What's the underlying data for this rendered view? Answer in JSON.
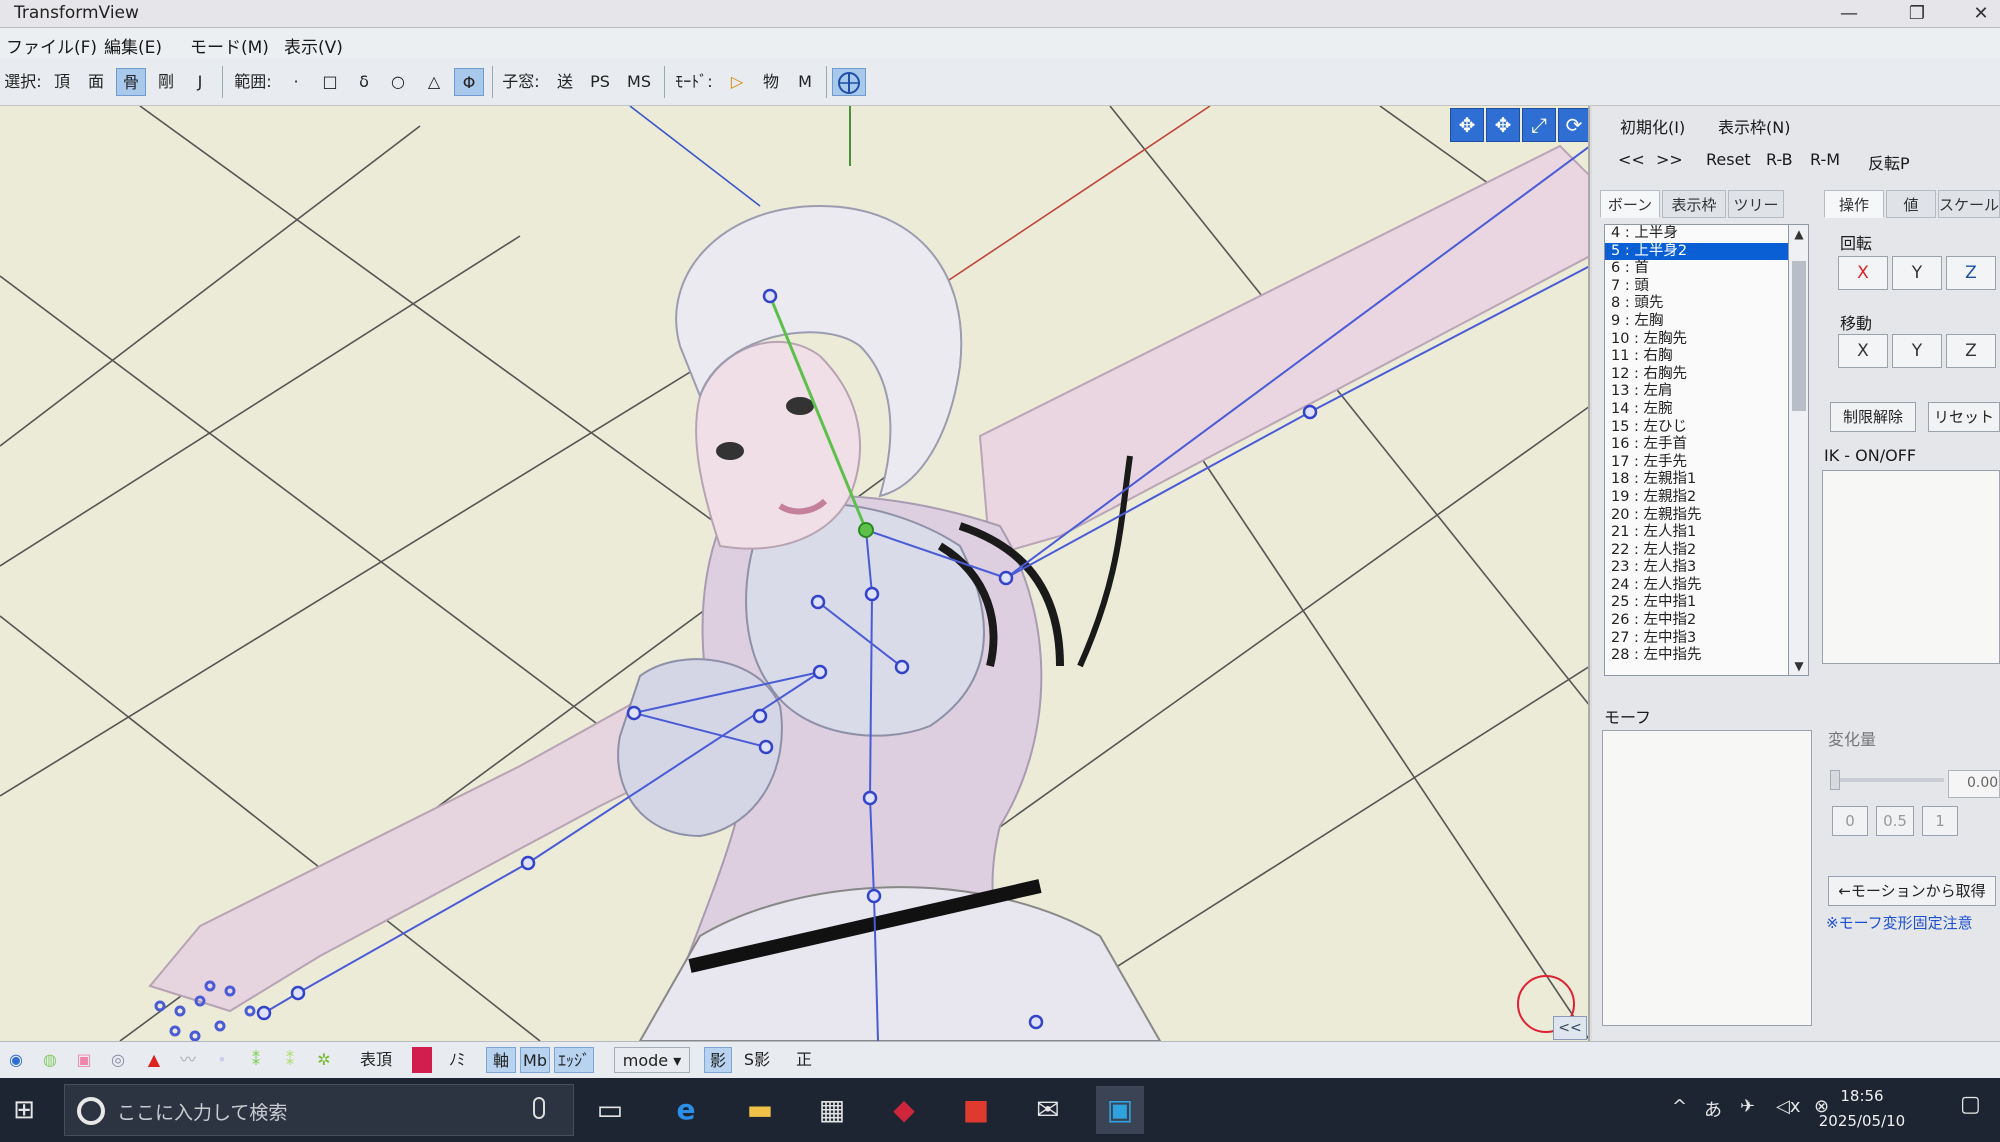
{
  "window": {
    "title": "TransformView",
    "buttons": [
      "—",
      "❐",
      "✕"
    ]
  },
  "menu": [
    "ファイル(F)",
    "編集(E)",
    "モード(M)",
    "表示(V)"
  ],
  "toolbar": {
    "select_label": "選択:",
    "select_items": [
      "頂",
      "面",
      "骨",
      "剛",
      "J"
    ],
    "range_label": "範囲:",
    "range_items": [
      "·",
      "□",
      "δ",
      "○",
      "△",
      "Φ"
    ],
    "child_label": "子窓:",
    "child_items": [
      "送",
      "PS",
      "MS"
    ],
    "mode_label": "ﾓｰﾄﾞ:",
    "mode_items": [
      "▷",
      "物",
      "M"
    ]
  },
  "right_panel": {
    "init_menu": "初期化(I)",
    "frame_menu": "表示枠(N)",
    "nav_buttons": [
      "<<",
      ">>",
      "Reset",
      "R-B",
      "R-M",
      "反転P"
    ],
    "left_tabs": [
      "ボーン",
      "表示枠",
      "ツリー"
    ],
    "right_tabs": [
      "操作",
      "値",
      "スケール"
    ],
    "bones": [
      "4 : 上半身",
      "5 : 上半身2",
      "6 : 首",
      "7 : 頭",
      "8 : 頭先",
      "9 : 左胸",
      "10 : 左胸先",
      "11 : 右胸",
      "12 : 右胸先",
      "13 : 左肩",
      "14 : 左腕",
      "15 : 左ひじ",
      "16 : 左手首",
      "17 : 左手先",
      "18 : 左親指1",
      "19 : 左親指2",
      "20 : 左親指先",
      "21 : 左人指1",
      "22 : 左人指2",
      "23 : 左人指3",
      "24 : 左人指先",
      "25 : 左中指1",
      "26 : 左中指2",
      "27 : 左中指3",
      "28 : 左中指先"
    ],
    "selected_bone_index": 1,
    "rotate_label": "回転",
    "move_label": "移動",
    "axes": [
      "X",
      "Y",
      "Z"
    ],
    "limit_release": "制限解除",
    "reset": "リセット",
    "ik_label": "IK - ON/OFF",
    "morph_label": "モーフ",
    "change_label": "変化量",
    "change_value": "0.00",
    "preset_values": [
      "0",
      "0.5",
      "1"
    ],
    "get_from_motion": "←モーションから取得",
    "morph_note": "※モーフ変形固定注意"
  },
  "bottom_toolbar": {
    "items": [
      "表頂",
      "ﾉﾐ",
      "軸",
      "Mb",
      "ｴｯｼﾞ",
      "mode ▾",
      "影",
      "S影",
      "正"
    ]
  },
  "taskbar": {
    "search_placeholder": "ここに入力して検索",
    "time": "18:56",
    "date": "2025/05/10"
  },
  "colors": {
    "viewport_bg": "#ecebd8",
    "bone_line": "#4a5bd6",
    "selected_bone": "#0b5fd4",
    "taskbar": "#1d2533",
    "tool_blue": "#2f6fd3"
  }
}
